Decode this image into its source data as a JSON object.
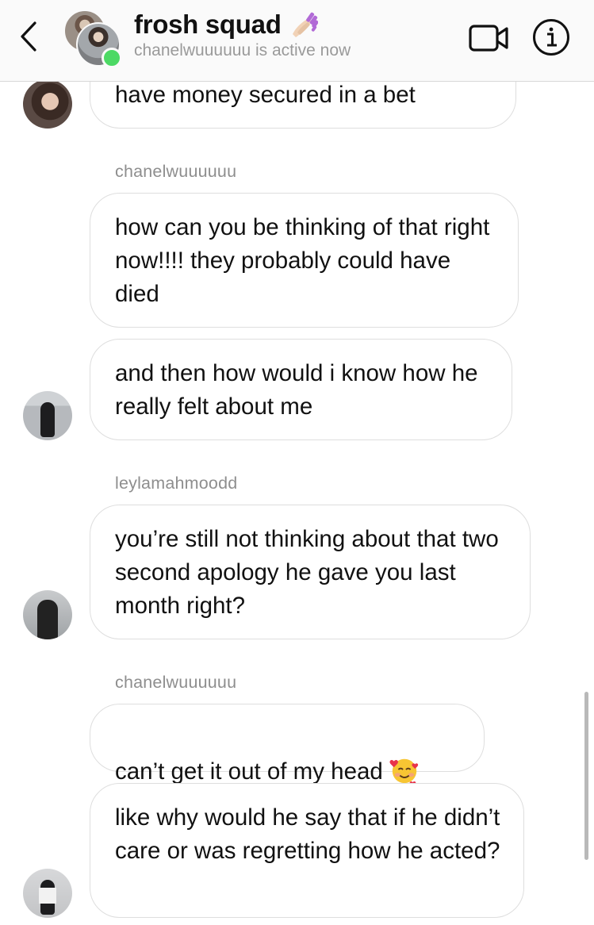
{
  "header": {
    "title": "frosh squad",
    "title_emoji_icon": "nail-polish-icon",
    "status": "chanelwuuuuuu is active now",
    "active_color": "#4cd964"
  },
  "messages": [
    {
      "type": "bubble",
      "text": "have money secured in a bet"
    },
    {
      "type": "sender",
      "text": "chanelwuuuuuu"
    },
    {
      "type": "bubble",
      "text": "how can you be thinking of that right now!!!! they probably could have died"
    },
    {
      "type": "bubble",
      "text": "and then how would i know how he really felt about me"
    },
    {
      "type": "sender",
      "text": "leylamahmoodd"
    },
    {
      "type": "bubble",
      "text": "you’re still not thinking about that two second apology he gave you last month right?"
    },
    {
      "type": "sender",
      "text": "chanelwuuuuuu"
    },
    {
      "type": "bubble",
      "text": "can’t get it out of my head",
      "emoji_icon": "smiling-face-with-hearts-icon"
    },
    {
      "type": "bubble",
      "text": "like why would he say that if he didn’t care or was regretting how he acted?"
    }
  ]
}
